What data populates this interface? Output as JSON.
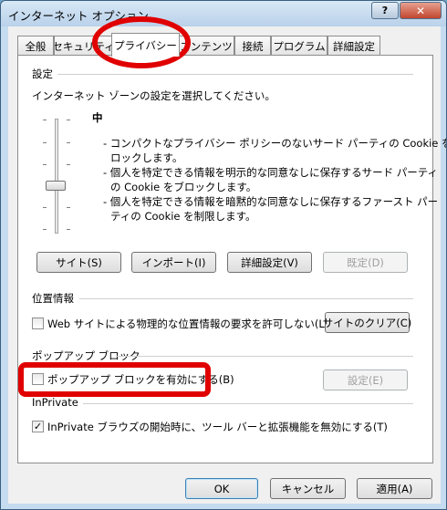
{
  "window": {
    "title": "インターネット オプション",
    "help_glyph": "?",
    "close_glyph": "✕"
  },
  "tabs": [
    {
      "label": "全般"
    },
    {
      "label": "セキュリティ"
    },
    {
      "label": "プライバシー"
    },
    {
      "label": "コンテンツ"
    },
    {
      "label": "接続"
    },
    {
      "label": "プログラム"
    },
    {
      "label": "詳細設定"
    }
  ],
  "active_tab": "プライバシー",
  "settings": {
    "group_title": "設定",
    "instruction": "インターネット ゾーンの設定を選択してください。",
    "level": "中",
    "description": [
      "- コンパクトなプライバシー ポリシーのないサード パーティの Cookie をブ",
      "ロックします。",
      "- 個人を特定できる情報を明示的な同意なしに保存するサード パーティ",
      "の Cookie をブロックします。",
      "- 個人を特定できる情報を暗黙的な同意なしに保存するファースト パー",
      "ティの Cookie を制限します。"
    ],
    "buttons": {
      "sites": "サイト(S)",
      "import": "インポート(I)",
      "advanced": "詳細設定(V)",
      "default": "既定(D)"
    }
  },
  "location": {
    "group_title": "位置情報",
    "checkbox_label": "Web サイトによる物理的な位置情報の要求を許可しない(L)",
    "checked": false,
    "clear_button": "サイトのクリア(C)"
  },
  "popup": {
    "group_title": "ポップアップ ブロック",
    "checkbox_label": "ポップアップ ブロックを有効にする(B)",
    "checked": false,
    "settings_button": "設定(E)"
  },
  "inprivate": {
    "group_title": "InPrivate",
    "checkbox_label": "InPrivate ブラウズの開始時に、ツール バーと拡張機能を無効にする(T)",
    "checked": true,
    "check_glyph": "✓"
  },
  "footer": {
    "ok": "OK",
    "cancel": "キャンセル",
    "apply": "適用(A)"
  },
  "highlight_color": "#e00000"
}
